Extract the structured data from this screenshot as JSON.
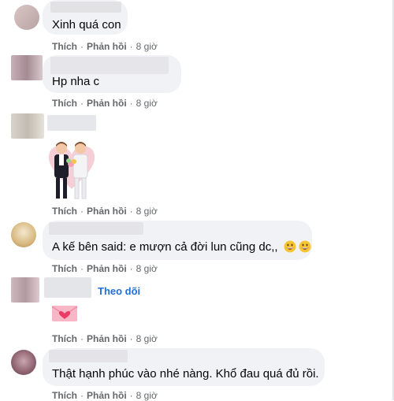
{
  "comments": [
    {
      "text": "Xinh quá con",
      "actions": {
        "like": "Thích",
        "reply": "Phản hồi",
        "time": "8 giờ"
      }
    },
    {
      "text": "Hp nha c",
      "actions": {
        "like": "Thích",
        "reply": "Phản hồi",
        "time": "8 giờ"
      }
    },
    {
      "text": "",
      "sticker": "wedding-couple-sticker",
      "actions": {
        "like": "Thích",
        "reply": "Phản hồi",
        "time": "8 giờ"
      }
    },
    {
      "text": "A kế bên said: e mượn cả đời lun cũng dc,,",
      "emojis": [
        "grinning-face-icon",
        "grinning-face-icon"
      ],
      "actions": {
        "like": "Thích",
        "reply": "Phản hồi",
        "time": "8 giờ"
      }
    },
    {
      "text": "",
      "follow": "Theo dõi",
      "sticker": "heart-envelope-sticker",
      "actions": {
        "like": "Thích",
        "reply": "Phản hồi",
        "time": "8 giờ"
      }
    },
    {
      "text": "Thật hạnh phúc vào nhé nàng. Khổ đau quá đủ rồi.",
      "actions": {
        "like": "Thích",
        "reply": "Phản hồi",
        "time": "8 giờ"
      }
    }
  ],
  "colors": {
    "bubble": "#f0f2f5",
    "meta": "#65676b",
    "link": "#216fdb",
    "text": "#050505"
  }
}
